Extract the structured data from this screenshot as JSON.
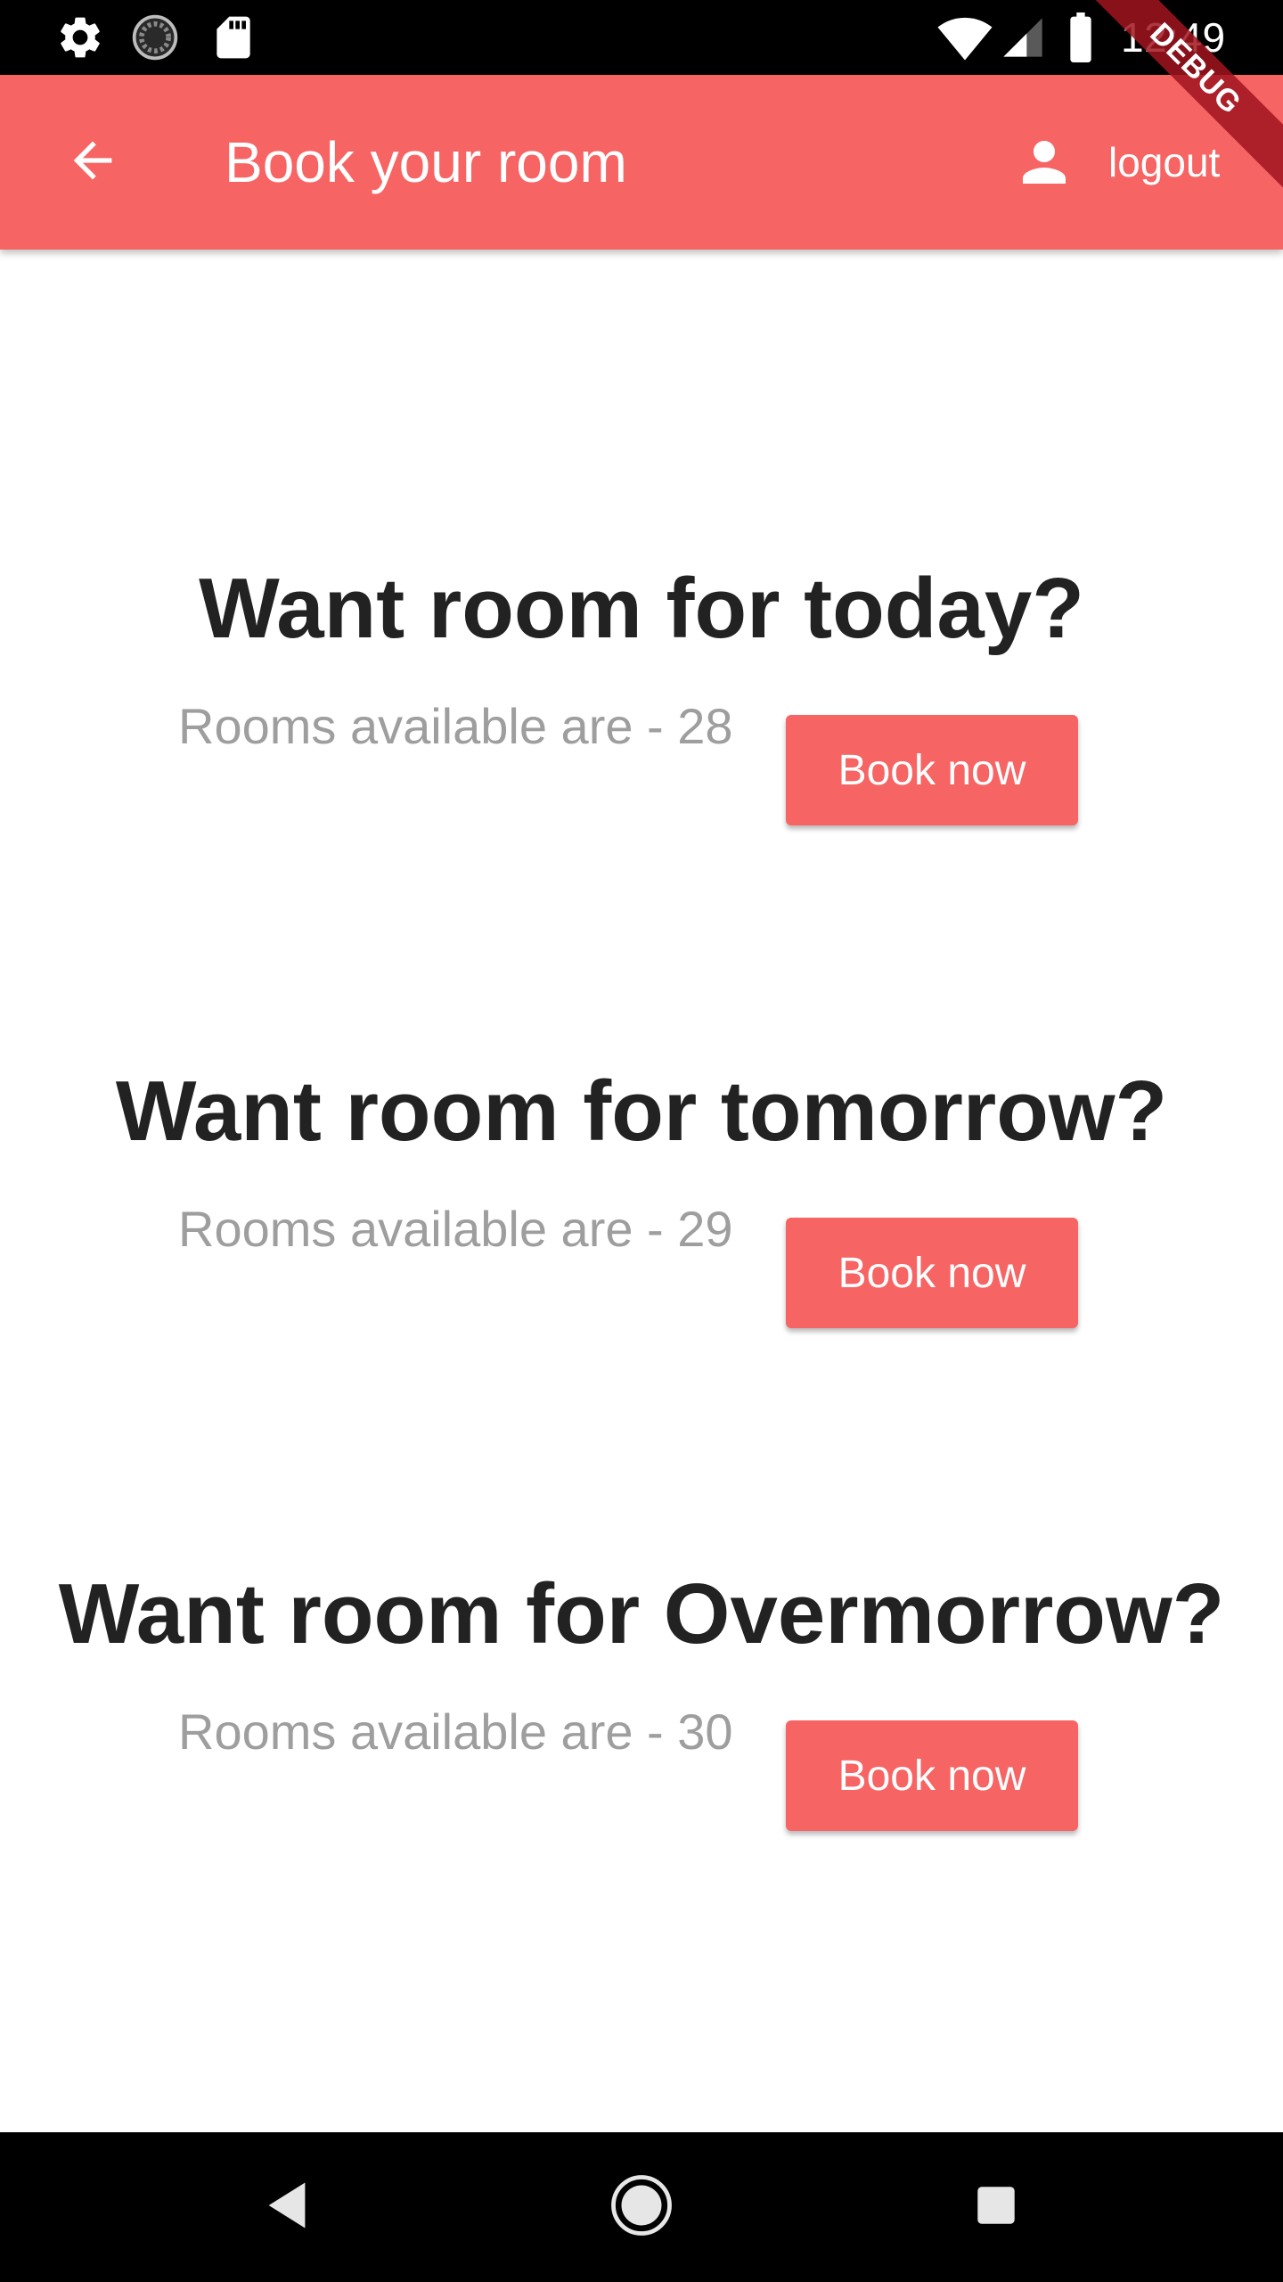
{
  "status_bar": {
    "time": "12:49",
    "left_icons": [
      "settings-icon",
      "loading-icon",
      "sd-card-icon"
    ],
    "right_icons": [
      "wifi-icon",
      "cell-signal-icon",
      "battery-icon"
    ]
  },
  "debug_banner": {
    "label": "DEBUG"
  },
  "app_bar": {
    "title": "Book your room",
    "back_icon": "arrow-back-icon",
    "logout_icon": "person-icon",
    "logout_label": "logout",
    "color": "#f76464"
  },
  "sections": [
    {
      "heading": "Want room for today?",
      "availability": "Rooms available are - 28",
      "button_label": "Book now"
    },
    {
      "heading": "Want room for tomorrow?",
      "availability": "Rooms available are - 29",
      "button_label": "Book now"
    },
    {
      "heading": "Want room for Overmorrow?",
      "availability": "Rooms available are - 30",
      "button_label": "Book now"
    }
  ],
  "nav_bar": {
    "icons": [
      "back-triangle-icon",
      "home-circle-icon",
      "recents-square-icon"
    ]
  }
}
